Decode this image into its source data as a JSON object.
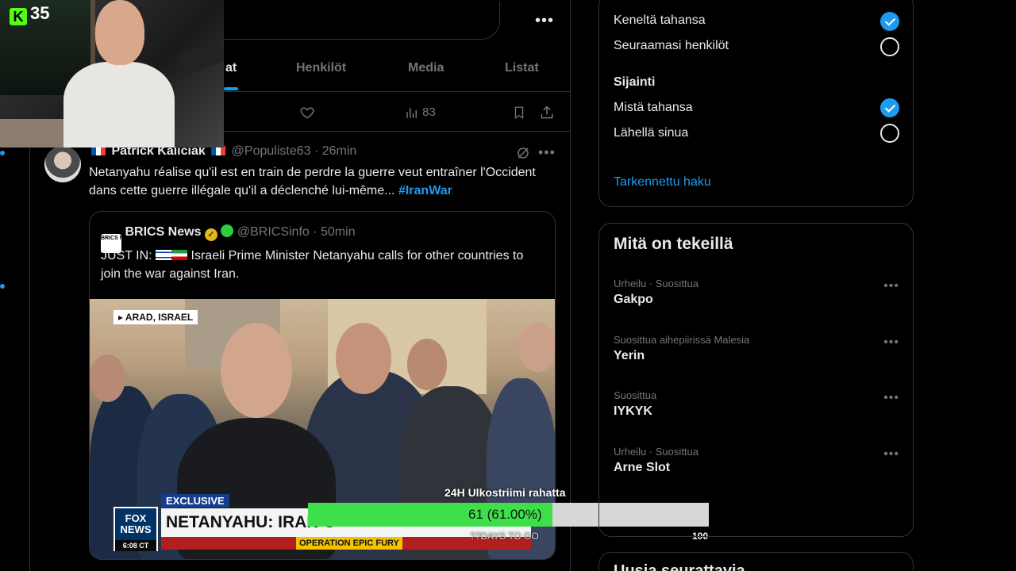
{
  "stream": {
    "viewer_count": "35",
    "goal": {
      "title": "24H Ulkostriimi rahatta",
      "value_text": "61 (61.00%)",
      "fraction": 0.61,
      "max_label": "100",
      "remaining": "??DAYS TO GO"
    }
  },
  "header": {
    "more_icon": "more-horizontal-icon"
  },
  "tabs": [
    {
      "label": "at",
      "active": true
    },
    {
      "label": "Henkilöt",
      "active": false
    },
    {
      "label": "Media",
      "active": false
    },
    {
      "label": "Listat",
      "active": false
    }
  ],
  "prev_tweet_actions": {
    "views": "83"
  },
  "tweet": {
    "name": "Patrick Kaliciak",
    "handle": "@Populiste63",
    "time": "· 26min",
    "text": "Netanyahu réalise qu'il est en train de perdre la guerre veut entraîner l'Occident dans cette guerre illégale qu'il a déclenché lui-même...",
    "hashtag": "#IranWar",
    "quote": {
      "logo_text": "BRICS NEWS",
      "name": "BRICS News",
      "handle": "@BRICSinfo",
      "time": "· 50min",
      "prefix": "JUST IN:",
      "text": "Israeli Prime Minister Netanyahu calls for other countries to join the war against Iran.",
      "image": {
        "location": "▸ ARAD, ISRAEL",
        "network_line1": "FOX",
        "network_line2": "NEWS",
        "clock": "6:08 CT",
        "exclusive": "EXCLUSIVE",
        "headline": "NETANYAHU: IRAN C",
        "ticker": "OPERATION EPIC FURY"
      }
    }
  },
  "sidebar": {
    "people_options": [
      {
        "label": "Keneltä tahansa",
        "selected": true
      },
      {
        "label": "Seuraamasi henkilöt",
        "selected": false
      }
    ],
    "location_title": "Sijainti",
    "location_options": [
      {
        "label": "Mistä tahansa",
        "selected": true
      },
      {
        "label": "Lähellä sinua",
        "selected": false
      }
    ],
    "advanced_link": "Tarkennettu haku",
    "trends_title": "Mitä on tekeillä",
    "trends": [
      {
        "meta": "Urheilu · Suosittua",
        "name": "Gakpo"
      },
      {
        "meta": "Suosittua aihepiirissä Malesia",
        "name": "Yerin"
      },
      {
        "meta": "Suosittua",
        "name": "IYKYK"
      },
      {
        "meta": "Urheilu · Suosittua",
        "name": "Arne Slot"
      }
    ],
    "next_card_title": "Uusia seurattavia"
  },
  "colors": {
    "accent": "#1d9bf0",
    "goal_fill": "#3ee049",
    "kick_green": "#53fc18"
  }
}
